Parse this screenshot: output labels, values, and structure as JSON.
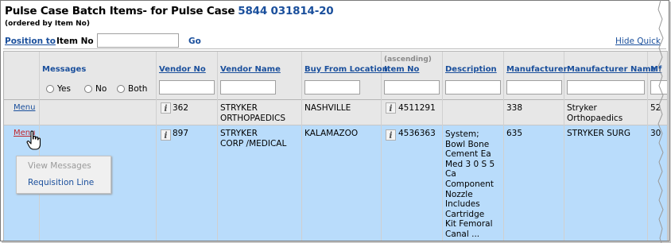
{
  "header": {
    "title_prefix": "Pulse Case Batch Items- for Pulse Case",
    "case_number": "5844  031814-20",
    "subtitle": "(ordered by Item No)"
  },
  "toolbar": {
    "position_to": "Position to",
    "item_no_label": "Item No",
    "go": "Go",
    "hide_quick": "Hide Quick"
  },
  "grid": {
    "columns": {
      "messages": "Messages",
      "vendor_no": "Vendor No",
      "vendor_name": "Vendor Name",
      "buy_from": "Buy From Location",
      "sort_note": "(ascending)",
      "item_no": "Item No",
      "description": "Description",
      "manufacturer": "Manufacturer",
      "manufacturer_name": "Manufacturer Name",
      "mf_partial": "Mf"
    },
    "filters": {
      "yes": "Yes",
      "no": "No",
      "both": "Both"
    },
    "rows": [
      {
        "menu": "Menu",
        "vendor_no": "362",
        "vendor_name": [
          "STRYKER",
          "ORTHOPAEDICS"
        ],
        "buy_from": "NASHVILLE",
        "item_no": "4511291",
        "description": [],
        "manufacturer": "338",
        "manufacturer_name": [
          "Stryker",
          "Orthopaedics"
        ],
        "mf": "52"
      },
      {
        "menu": "Menu",
        "vendor_no": "897",
        "vendor_name": [
          "STRYKER",
          "CORP /MEDICAL"
        ],
        "buy_from": "KALAMAZOO",
        "item_no": "4536363",
        "description": [
          "System;",
          "Bowl Bone",
          "Cement Ea",
          "Med 3 0 S 5",
          "Ca",
          "Component",
          "Nozzle",
          "Includes",
          "Cartridge",
          "Kit Femoral",
          "Canal ..."
        ],
        "manufacturer": "635",
        "manufacturer_name": [
          "STRYKER SURG"
        ],
        "mf": "30"
      }
    ]
  },
  "context_menu": {
    "items": [
      {
        "label": "View Messages",
        "enabled": false
      },
      {
        "label": "Requisition Line",
        "enabled": true
      }
    ]
  },
  "colors": {
    "link": "#1a4f9c",
    "selected_row": "#b9dcfb",
    "header_bg": "#e7e7e7",
    "active_menu": "#c0262b"
  }
}
